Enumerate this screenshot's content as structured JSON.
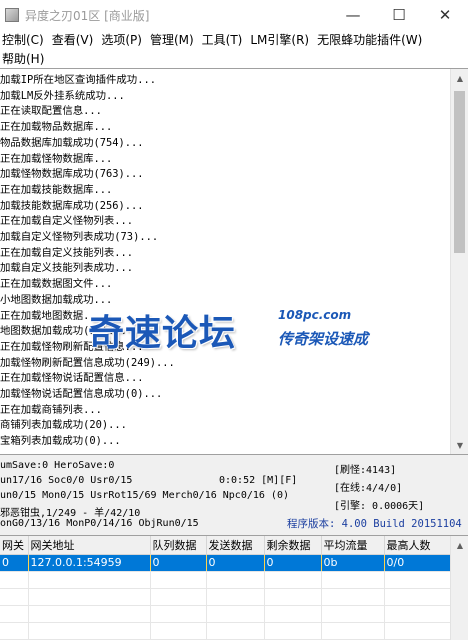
{
  "window": {
    "title": "异度之刃01区 [商业版]",
    "minimize": "—",
    "maximize": "☐",
    "close": "✕"
  },
  "menu": {
    "row1": [
      "控制(C)",
      "查看(V)",
      "选项(P)",
      "管理(M)",
      "工具(T)",
      "LM引擎(R)",
      "无限蜂功能插件(W)"
    ],
    "row2": [
      "帮助(H)"
    ]
  },
  "log": {
    "lines": [
      "加载IP所在地区查询插件成功...",
      "加载LM反外挂系统成功...",
      "正在读取配置信息...",
      "正在加载物品数据库...",
      "物品数据库加载成功(754)...",
      "正在加载怪物数据库...",
      "加载怪物数据库成功(763)...",
      "正在加载技能数据库...",
      "加载技能数据库成功(256)...",
      "正在加载自定义怪物列表...",
      "加载自定义怪物列表成功(73)...",
      "正在加载自定义技能列表...",
      "加载自定义技能列表成功...",
      "正在加载数据图文件...",
      "小地图数据加载成功...",
      "正在加载地图数据...",
      "地图数据加载成功(92)...",
      "正在加载怪物刷新配置信息...",
      "加载怪物刷新配置信息成功(249)...",
      "正在加载怪物说话配置信息...",
      "加载怪物说话配置信息成功(0)...",
      "正在加载商铺列表...",
      "商铺列表加载成功(20)...",
      "宝箱列表加载成功(0)..."
    ]
  },
  "watermark": {
    "main": "奇速论坛",
    "domain": "108pc.com",
    "slogan": "传奇架设速成"
  },
  "status": {
    "line1": "umSave:0 HeroSave:0",
    "line2": "un17/16 Soc0/0 Usr0/15",
    "time": "0:0:52 [M][F]",
    "line3": "un0/15 Mon0/15 UsrRot15/69 Merch0/16 Npc0/16 (0)",
    "line4": "邪恶钳虫,1/249 - 羊/42/10",
    "line5": "onG0/13/16 MonP0/14/16 ObjRun0/15",
    "refresh": "[刷怪:4143]",
    "online": "[在线:4/4/0]",
    "engine": "[引擎: 0.0006天]",
    "version": "程序版本: 4.00 Build 20151104"
  },
  "grid": {
    "columns": [
      "网关",
      "网关地址",
      "队列数据",
      "发送数据",
      "剩余数据",
      "平均流量",
      "最高人数"
    ],
    "rows": [
      [
        "0",
        "127.0.0.1:54959",
        "0",
        "0",
        "0",
        "0b",
        "0/0"
      ]
    ]
  }
}
